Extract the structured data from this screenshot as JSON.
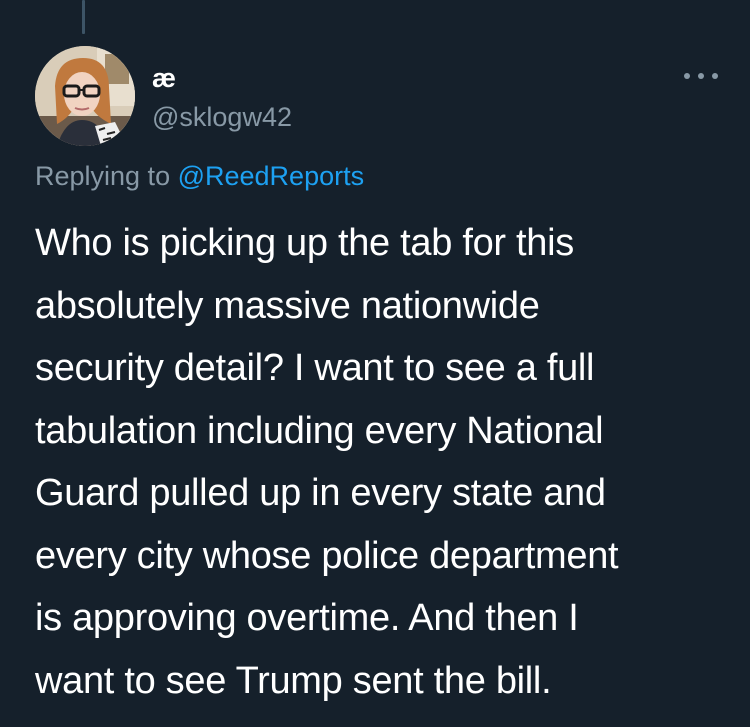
{
  "tweet": {
    "display_name": "æ",
    "handle": "@sklogw42",
    "replying_prefix": "Replying to",
    "replying_to": "@ReedReports",
    "text_lines": [
      "Who is picking up the tab for this",
      "absolutely massive nationwide",
      "security detail? I want to see a full",
      "tabulation including every National",
      "Guard pulled up in every state and",
      "every city whose police department",
      "is approving overtime. And then I",
      "want to see Trump sent the bill."
    ],
    "more_icon": "more-horizontal-icon"
  },
  "colors": {
    "background": "#15202b",
    "text_primary": "#ffffff",
    "text_secondary": "#8899a6",
    "link": "#1da1f2",
    "thread_line": "#3d5466"
  }
}
